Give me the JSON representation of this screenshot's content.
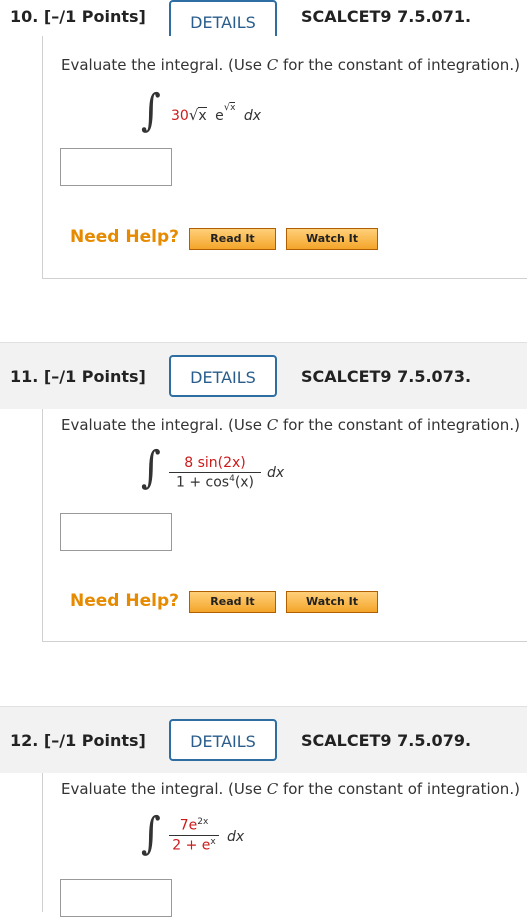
{
  "questions": [
    {
      "number": "10.",
      "points": "[–/1 Points]",
      "details_label": "DETAILS",
      "code": "SCALCET9 7.5.071.",
      "prompt_before": "Evaluate the integral. (Use ",
      "prompt_var": "C",
      "prompt_after": " for the constant of integration.)",
      "integrand": {
        "coef": "30",
        "sqrt_arg": "x",
        "exp_base": "e",
        "exp_sqrt_arg": "x",
        "dx": "dx"
      },
      "answer_value": "",
      "help_label": "Need Help?",
      "read_label": "Read It",
      "watch_label": "Watch It"
    },
    {
      "number": "11.",
      "points": "[–/1 Points]",
      "details_label": "DETAILS",
      "code": "SCALCET9 7.5.073.",
      "prompt_before": "Evaluate the integral. (Use ",
      "prompt_var": "C",
      "prompt_after": " for the constant of integration.)",
      "integrand": {
        "numerator": "8 sin(2x)",
        "den_pre": "1 + cos",
        "den_pow": "4",
        "den_post": "(x)",
        "dx": "dx"
      },
      "answer_value": "",
      "help_label": "Need Help?",
      "read_label": "Read It",
      "watch_label": "Watch It"
    },
    {
      "number": "12.",
      "points": "[–/1 Points]",
      "details_label": "DETAILS",
      "code": "SCALCET9 7.5.079.",
      "prompt_before": "Evaluate the integral. (Use ",
      "prompt_var": "C",
      "prompt_after": " for the constant of integration.)",
      "integrand": {
        "num_pre": "7e",
        "num_pow": "2x",
        "den_pre": "2 + e",
        "den_pow": "x",
        "dx": "dx"
      },
      "answer_value": ""
    }
  ],
  "colors": {
    "accent": "#2e6ea3",
    "help": "#e68a00",
    "red": "#cc1a1a"
  }
}
